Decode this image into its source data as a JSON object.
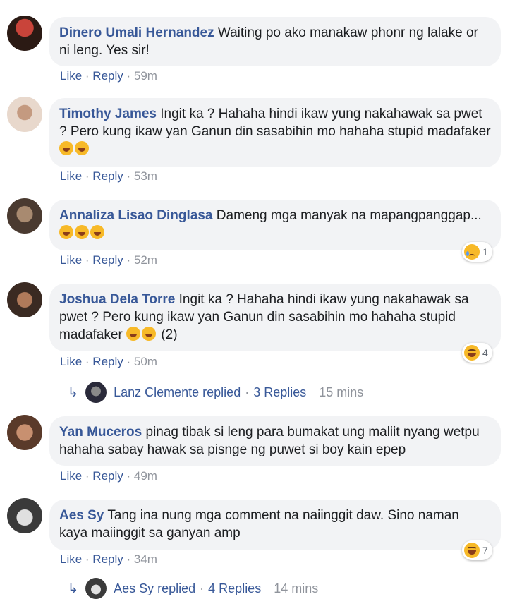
{
  "comments": [
    {
      "author": "Dinero Umali Hernandez",
      "text": "Waiting po ako manakaw phonr ng lalake or ni leng. Yes sir!",
      "like": "Like",
      "reply": "Reply",
      "time": "59m",
      "avatar_colors": [
        "#2b1a14",
        "#c9443a"
      ]
    },
    {
      "author": "Timothy James",
      "text": "Ingit ka ? Hahaha hindi ikaw yung nakahawak sa pwet ? Pero kung ikaw yan Ganun din sasabihin mo hahaha stupid madafaker",
      "like": "Like",
      "reply": "Reply",
      "time": "53m",
      "avatar_colors": [
        "#e8d8cc",
        "#6a4a3a"
      ]
    },
    {
      "author": "Annaliza Lisao Dinglasa",
      "text": "Dameng mga manyak na mapangpanggap...",
      "like": "Like",
      "reply": "Reply",
      "time": "52m",
      "reaction": {
        "icon": "sad-emoji-icon",
        "count": "1"
      },
      "avatar_colors": [
        "#a88a70",
        "#4a3a30"
      ]
    },
    {
      "author": "Joshua Dela Torre",
      "text": "Ingit ka ? Hahaha hindi ikaw yung nakahawak sa pwet ? Pero kung ikaw yan Ganun din sasabihin mo hahaha stupid madafaker",
      "suffix": "(2)",
      "like": "Like",
      "reply": "Reply",
      "time": "50m",
      "reaction": {
        "icon": "haha-emoji-icon",
        "count": "4"
      },
      "avatar_colors": [
        "#3a2a22",
        "#b07a5a"
      ]
    },
    {
      "author": "Yan Muceros",
      "text": "pinag tibak si leng para bumakat ung maliit nyang wetpu hahaha sabay hawak sa pisnge ng puwet si boy kain epep",
      "like": "Like",
      "reply": "Reply",
      "time": "49m",
      "avatar_colors": [
        "#c89070",
        "#5a3a2a"
      ]
    },
    {
      "author": "Aes Sy",
      "text": "Tang ina nung mga comment na naiinggit daw. Sino naman kaya maiinggit sa ganyan amp",
      "like": "Like",
      "reply": "Reply",
      "time": "34m",
      "reaction": {
        "icon": "haha-emoji-icon",
        "count": "7"
      },
      "avatar_colors": [
        "#e0e0e0",
        "#3a3a3a"
      ]
    }
  ],
  "replies": [
    {
      "name": "Lanz Clemente replied",
      "sep": "·",
      "count": "3 Replies",
      "time": "15 mins"
    },
    {
      "name": "Aes Sy replied",
      "sep": "·",
      "count": "4 Replies",
      "time": "14 mins"
    }
  ],
  "colors": {
    "link": "#385898",
    "bubble": "#f2f3f5",
    "meta": "#90949c",
    "emoji": "#f7b928"
  }
}
